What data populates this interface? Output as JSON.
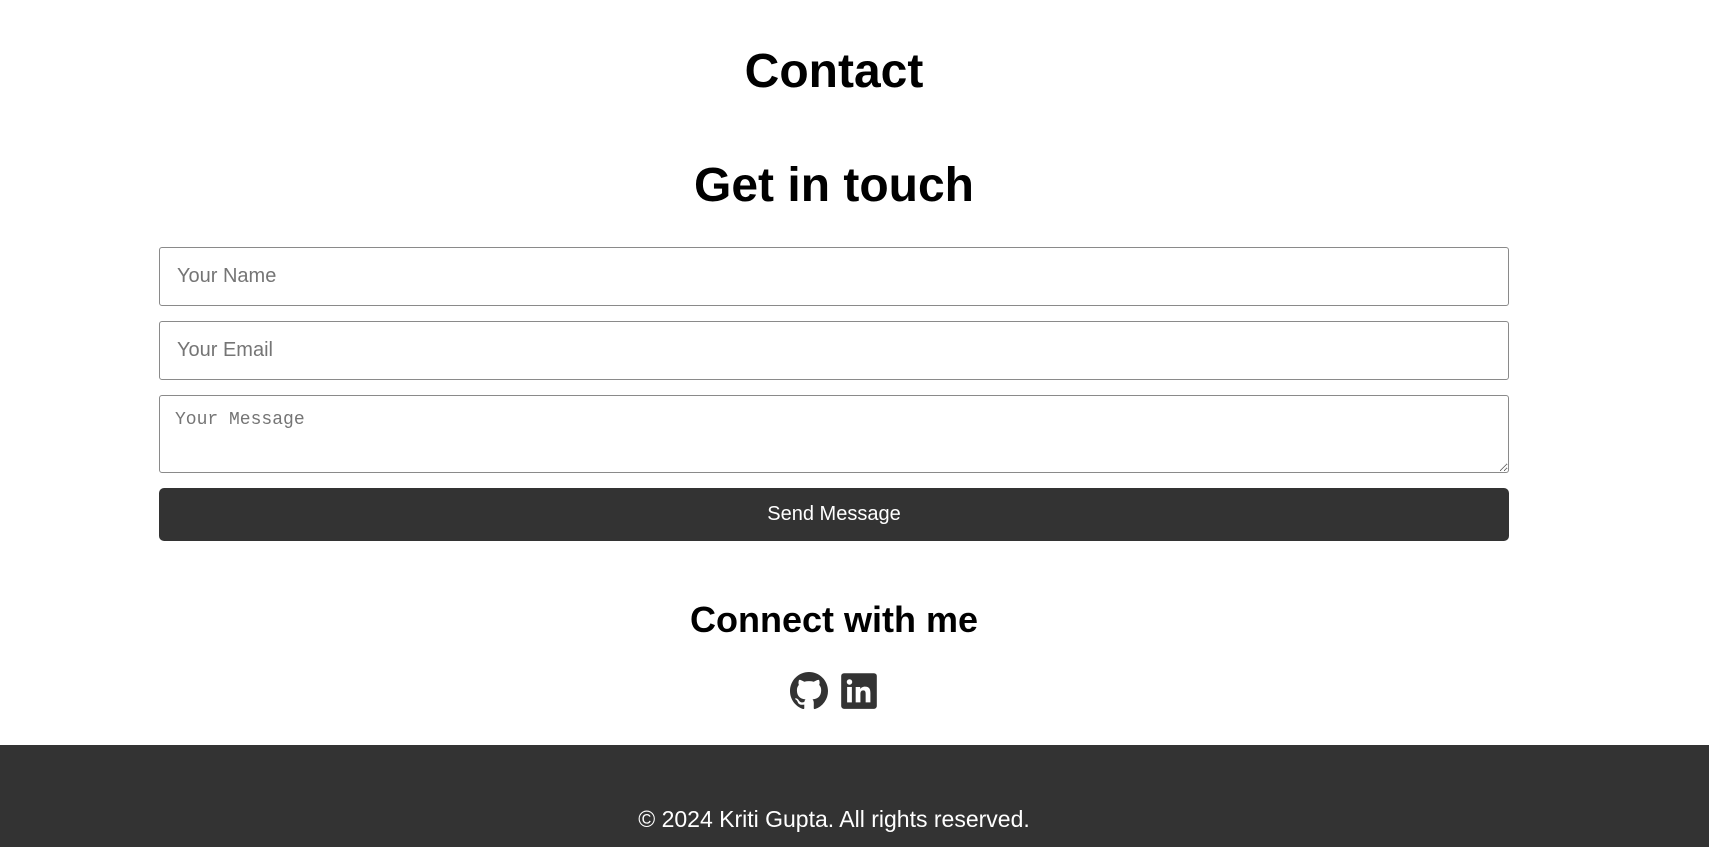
{
  "header": {
    "title": "Contact"
  },
  "contact_form": {
    "title": "Get in touch",
    "name_placeholder": "Your Name",
    "email_placeholder": "Your Email",
    "message_placeholder": "Your Message",
    "name_value": "",
    "email_value": "",
    "message_value": "",
    "submit_label": "Send Message"
  },
  "social": {
    "title": "Connect with me",
    "links": [
      {
        "icon": "github-icon"
      },
      {
        "icon": "linkedin-icon"
      }
    ]
  },
  "footer": {
    "copyright": "© 2024 Kriti Gupta. All rights reserved."
  },
  "colors": {
    "background": "#ffffff",
    "button_bg": "#333333",
    "footer_bg": "#333333",
    "text": "#000000",
    "footer_text": "#ffffff"
  }
}
